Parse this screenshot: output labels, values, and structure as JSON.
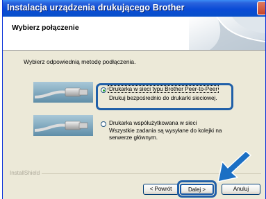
{
  "window": {
    "title": "Instalacja urządzenia drukującego Brother"
  },
  "header": {
    "title": "Wybierz połączenie"
  },
  "instruction": "Wybierz odpowiednią metodę podłączenia.",
  "options": [
    {
      "label": "Drukarka w sieci typu Brother Peer-to-Peer",
      "desc": "Drukuj bezpośrednio do drukarki sieciowej.",
      "selected": true
    },
    {
      "label": "Drukarka współużytkowana w sieci",
      "desc": "Wszystkie zadania są wysyłane do kolejki na serwerze głównym.",
      "selected": false
    }
  ],
  "footer": {
    "brand": "InstallShield",
    "back_label": "< Powrót",
    "next_label": "Dalej >",
    "cancel_label": "Anuluj"
  },
  "colors": {
    "titlebar": "#0a4bd6",
    "highlight": "#1f5fa8",
    "arrow": "#1b6fc4",
    "dialog_bg": "#ece9d8"
  }
}
